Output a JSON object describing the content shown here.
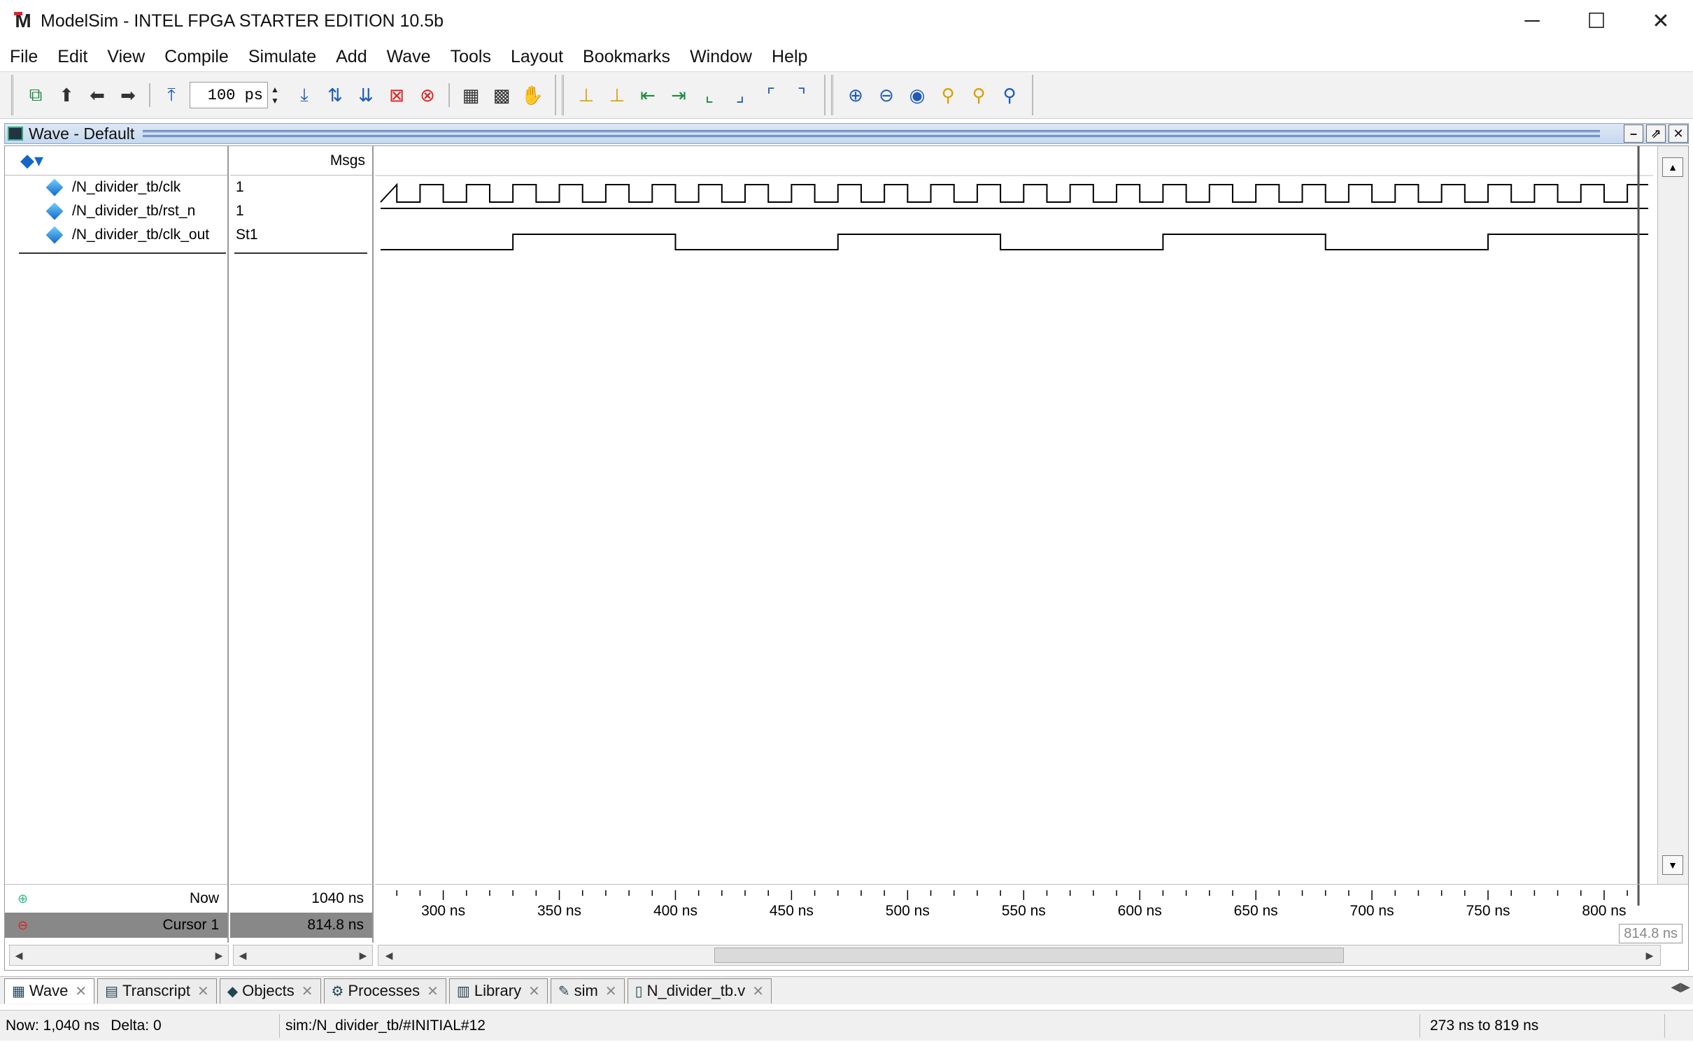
{
  "window": {
    "title": "ModelSim - INTEL FPGA STARTER EDITION 10.5b",
    "logo": "M",
    "minimize": "─",
    "maximize": "☐",
    "close": "✕"
  },
  "menu": [
    "File",
    "Edit",
    "View",
    "Compile",
    "Simulate",
    "Add",
    "Wave",
    "Tools",
    "Layout",
    "Bookmarks",
    "Window",
    "Help"
  ],
  "toolbar": {
    "run_length": "100 ps",
    "spin_up": "▲",
    "spin_down": "▼"
  },
  "wave_window": {
    "title": "Wave - Default",
    "btn_minimize": "–",
    "btn_undock": "⇗",
    "btn_close": "✕",
    "messages_header": "Msgs",
    "signals": [
      {
        "name": "/N_divider_tb/clk",
        "value": "1"
      },
      {
        "name": "/N_divider_tb/rst_n",
        "value": "1"
      },
      {
        "name": "/N_divider_tb/clk_out",
        "value": "St1"
      }
    ],
    "now_label": "Now",
    "now_value": "1040 ns",
    "cursor_label": "Cursor 1",
    "cursor_value": "814.8 ns",
    "cursor_badge": "814.8 ns",
    "time_axis_labels": [
      "300 ns",
      "350 ns",
      "400 ns",
      "450 ns",
      "500 ns",
      "550 ns",
      "600 ns",
      "650 ns",
      "700 ns",
      "750 ns",
      "800 ns"
    ],
    "visible_range_ns": [
      273,
      819
    ],
    "cursor_time_ns": 814.8,
    "clk_period_ns": 20,
    "clk_out_toggle_ns": [
      330,
      400,
      470,
      540,
      610,
      680,
      750
    ]
  },
  "tabs": [
    {
      "label": "Wave",
      "icon": "▦",
      "active": true
    },
    {
      "label": "Transcript",
      "icon": "▤",
      "active": false
    },
    {
      "label": "Objects",
      "icon": "◆",
      "active": false
    },
    {
      "label": "Processes",
      "icon": "⚙",
      "active": false
    },
    {
      "label": "Library",
      "icon": "▥",
      "active": false
    },
    {
      "label": "sim",
      "icon": "✎",
      "active": false
    },
    {
      "label": "N_divider_tb.v",
      "icon": "▯",
      "active": false
    }
  ],
  "tab_close": "✕",
  "status": {
    "now": "Now: 1,040 ns",
    "delta": "Delta: 0",
    "context": "sim:/N_divider_tb/#INITIAL#12",
    "range": "273 ns to 819 ns"
  }
}
